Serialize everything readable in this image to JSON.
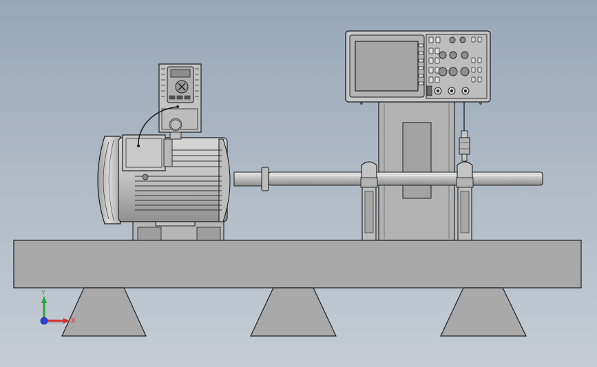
{
  "viewport": {
    "background_top": "#97a7b9",
    "background_bottom": "#c5ccd3",
    "model_fill": "#a9a9a9",
    "model_stroke": "#1e1e1e"
  },
  "triad": {
    "x_label": "X",
    "y_label": "Y",
    "x_color": "#d93030",
    "y_color": "#2aa53a",
    "z_color": "#2c3fd6"
  }
}
